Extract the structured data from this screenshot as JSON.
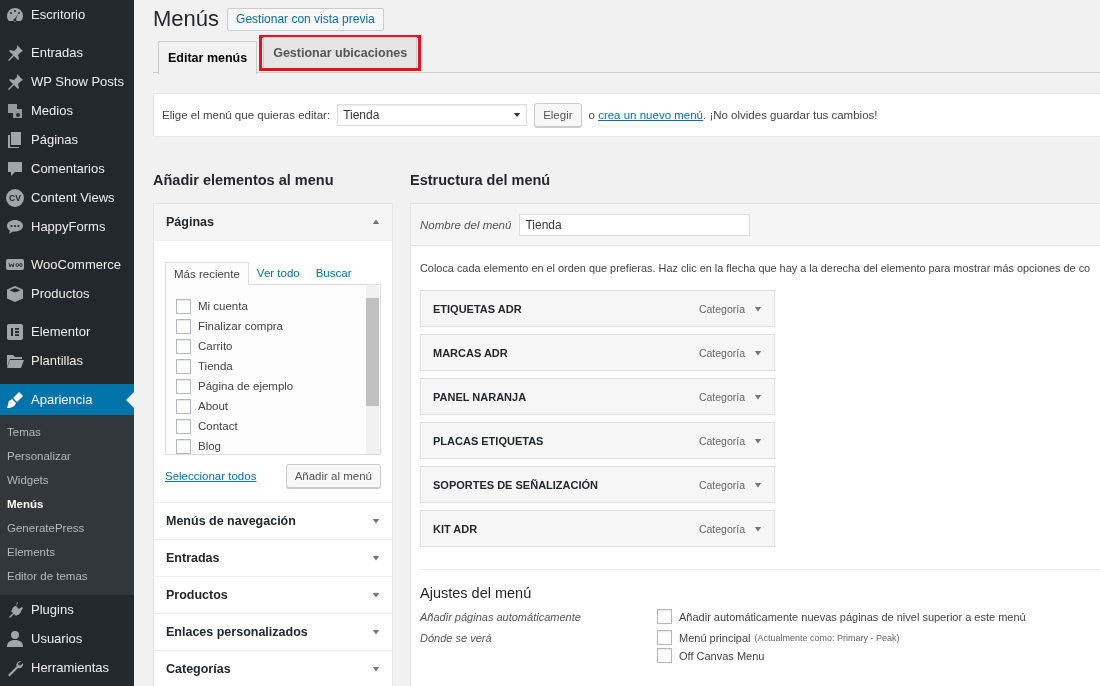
{
  "sidebar": {
    "groups": [
      [
        {
          "label": "Escritorio",
          "selected": false
        }
      ],
      [
        {
          "label": "Entradas",
          "selected": false
        },
        {
          "label": "WP Show Posts",
          "selected": false
        },
        {
          "label": "Medios",
          "selected": false
        },
        {
          "label": "Páginas",
          "selected": false
        },
        {
          "label": "Comentarios",
          "selected": false
        },
        {
          "label": "Content Views",
          "selected": false,
          "icon_text": "CV"
        },
        {
          "label": "HappyForms",
          "selected": false
        }
      ],
      [
        {
          "label": "WooCommerce",
          "selected": false
        },
        {
          "label": "Productos",
          "selected": false
        }
      ],
      [
        {
          "label": "Elementor",
          "selected": false
        },
        {
          "label": "Plantillas",
          "selected": false
        }
      ],
      [
        {
          "label": "Apariencia",
          "selected": true,
          "children": [
            {
              "label": "Temas",
              "selected": false
            },
            {
              "label": "Personalizar",
              "selected": false
            },
            {
              "label": "Widgets",
              "selected": false
            },
            {
              "label": "Menús",
              "selected": true
            },
            {
              "label": "GeneratePress",
              "selected": false
            },
            {
              "label": "Elements",
              "selected": false
            },
            {
              "label": "Editor de temas",
              "selected": false
            }
          ]
        },
        {
          "label": "Plugins",
          "selected": false
        },
        {
          "label": "Usuarios",
          "selected": false
        },
        {
          "label": "Herramientas",
          "selected": false
        }
      ]
    ]
  },
  "page": {
    "title": "Menús",
    "preview_button": "Gestionar con vista previa"
  },
  "tabs": [
    {
      "label": "Editar menús",
      "selected": true,
      "highlighted": false
    },
    {
      "label": "Gestionar ubicaciones",
      "selected": false,
      "highlighted": true
    }
  ],
  "menu_chooser": {
    "label": "Elige el menú que quieras editar:",
    "value": "Tienda",
    "button": "Elegir",
    "prefix": "o ",
    "link": "crea un nuevo menú",
    "suffix": ". ¡No olvides guardar tus cambios!"
  },
  "add_items": {
    "heading": "Añadir elementos al menu",
    "sections": [
      {
        "title": "Páginas",
        "expanded": true,
        "tabs": [
          {
            "label": "Más reciente",
            "selected": true
          },
          {
            "label": "Ver todo",
            "selected": false
          },
          {
            "label": "Buscar",
            "selected": false
          }
        ],
        "items": [
          {
            "label": "Mi cuenta",
            "checked": false
          },
          {
            "label": "Finalizar compra",
            "checked": false
          },
          {
            "label": "Carrito",
            "checked": false
          },
          {
            "label": "Tienda",
            "checked": false
          },
          {
            "label": "Página de ejemplo",
            "checked": false
          },
          {
            "label": "About",
            "checked": false
          },
          {
            "label": "Contact",
            "checked": false
          },
          {
            "label": "Blog",
            "checked": false
          }
        ],
        "select_all": "Seleccionar todos",
        "add_button": "Añadir al menú"
      },
      {
        "title": "Menús de navegación",
        "expanded": false
      },
      {
        "title": "Entradas",
        "expanded": false
      },
      {
        "title": "Productos",
        "expanded": false
      },
      {
        "title": "Enlaces personalizados",
        "expanded": false
      },
      {
        "title": "Categorías",
        "expanded": false
      }
    ]
  },
  "structure": {
    "heading": "Estructura del menú",
    "name_label": "Nombre del menú",
    "name_value": "Tienda",
    "instructions": "Coloca cada elemento en el orden que prefieras. Haz clic en la flecha que hay a la derecha del elemento para mostrar más opciones de co",
    "items": [
      {
        "title": "ETIQUETAS ADR",
        "type": "Categoría"
      },
      {
        "title": "MARCAS ADR",
        "type": "Categoría"
      },
      {
        "title": "PANEL NARANJA",
        "type": "Categoría"
      },
      {
        "title": "PLACAS ETIQUETAS",
        "type": "Categoría"
      },
      {
        "title": "SOPORTES DE SEÑALIZACIÓN",
        "type": "Categoría"
      },
      {
        "title": "KIT ADR",
        "type": "Categoría"
      }
    ]
  },
  "settings": {
    "heading": "Ajustes del menú",
    "rows": [
      {
        "label": "Añadir páginas automáticamente",
        "options": [
          {
            "label": "Añadir automáticamente nuevas páginas de nivel superior a este menú",
            "checked": false
          }
        ]
      },
      {
        "label": "Dónde se verá",
        "options": [
          {
            "label": "Menú principal",
            "note": "(Actualmente como: Primary - Peak)",
            "checked": false
          },
          {
            "label": "Off Canvas Menu",
            "checked": false
          }
        ]
      }
    ]
  }
}
